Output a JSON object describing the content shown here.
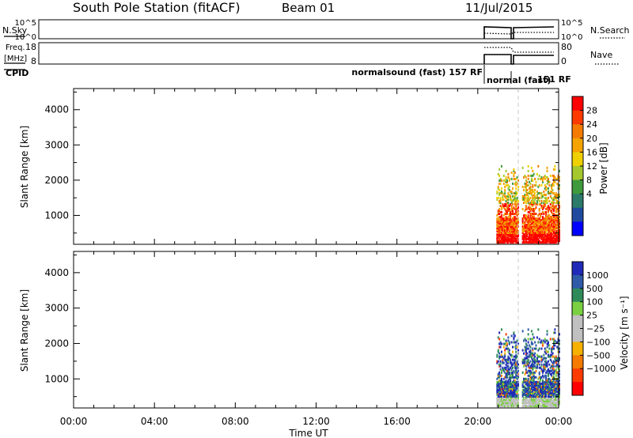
{
  "header": {
    "station": "South Pole Station (fitACF)",
    "beam": "Beam 01",
    "date": "11/Jul/2015"
  },
  "noise_panel": {
    "left_label": "N.Sky",
    "left_ticks": [
      "10^5",
      "10^0"
    ],
    "right_label": "N.Search",
    "right_ticks": [
      "10^5",
      "10^0"
    ]
  },
  "freq_panel": {
    "left_label_1": "Freq.",
    "left_label_2": "[MHz]",
    "left_ticks": [
      "18",
      "8"
    ],
    "right_label": "Nave",
    "right_ticks": [
      "80",
      "0"
    ]
  },
  "cpid": {
    "label": "CPID",
    "mode_1": "normalsound (fast) 157 RF",
    "mode_2": "normal (fast)",
    "mode_2_code": "151 RF"
  },
  "chart_data": [
    {
      "type": "heatmap",
      "name": "power",
      "ylabel": "Slant Range [km]",
      "colorbar_label": "Power [dB]",
      "ylim": [
        180,
        4600
      ],
      "y_ticks": [
        "1000",
        "2000",
        "3000",
        "4000"
      ],
      "colorbar_ticks": [
        "28",
        "24",
        "20",
        "16",
        "12",
        "8",
        "4"
      ],
      "colorbar_colors": [
        "#ff0000",
        "#ff3a00",
        "#f47b00",
        "#f5a300",
        "#efd000",
        "#a4c82e",
        "#3f9a3e",
        "#2b7a6a",
        "#1f4aa0",
        "#0000ff"
      ]
    },
    {
      "type": "heatmap",
      "name": "velocity",
      "xlabel": "Time UT",
      "ylabel": "Slant Range [km]",
      "colorbar_label": "Velocity [m s⁻¹]",
      "ylim": [
        180,
        4600
      ],
      "y_ticks": [
        "1000",
        "2000",
        "3000",
        "4000"
      ],
      "x_ticks": [
        "00:00",
        "04:00",
        "08:00",
        "12:00",
        "16:00",
        "20:00",
        "00:00"
      ],
      "colorbar_ticks": [
        "1000",
        "500",
        "100",
        "25",
        "−25",
        "−100",
        "−500",
        "−1000"
      ],
      "colorbar_colors": [
        "#1f2ab8",
        "#2f5aa8",
        "#2f8a5a",
        "#7ad040",
        "#c0c0c0",
        "#c0c0c0",
        "#f5b000",
        "#f57a00",
        "#ff3a00",
        "#ff0000"
      ]
    }
  ]
}
